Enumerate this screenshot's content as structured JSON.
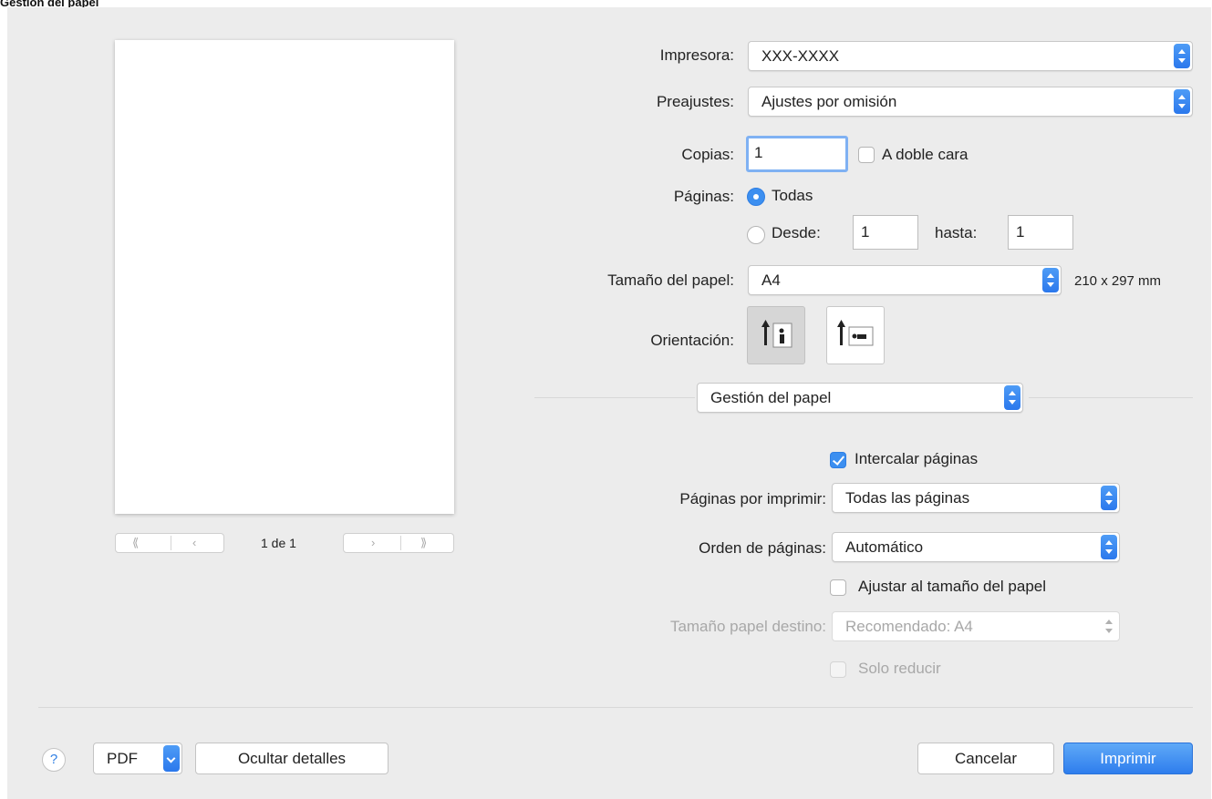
{
  "window": {
    "title": "Gestión del papel"
  },
  "preview": {
    "page_indicator": "1 de 1"
  },
  "printer": {
    "label": "Impresora:",
    "value": "XXX-XXXX"
  },
  "presets": {
    "label": "Preajustes:",
    "value": "Ajustes por omisión"
  },
  "copies": {
    "label": "Copias:",
    "value": "1",
    "duplex_label": "A doble cara",
    "duplex_checked": false
  },
  "pages": {
    "label": "Páginas:",
    "all_label": "Todas",
    "from_label": "Desde:",
    "from_value": "1",
    "to_label": "hasta:",
    "to_value": "1"
  },
  "paper_size": {
    "label": "Tamaño del papel:",
    "value": "A4",
    "dimensions": "210 x 297 mm"
  },
  "orientation": {
    "label": "Orientación:",
    "options": [
      "portrait-icon",
      "landscape-icon"
    ],
    "selected": "portrait"
  },
  "section": {
    "value": "Gestión del papel"
  },
  "paper_handling": {
    "collate_label": "Intercalar páginas",
    "collate_checked": true,
    "pages_to_print_label": "Páginas por imprimir:",
    "pages_to_print_value": "Todas las páginas",
    "page_order_label": "Orden de páginas:",
    "page_order_value": "Automático",
    "scale_to_fit_label": "Ajustar al tamaño del papel",
    "scale_to_fit_checked": false,
    "destination_size_label": "Tamaño papel destino:",
    "destination_size_value": "Recomendado: A4",
    "scale_down_only_label": "Solo reducir"
  },
  "footer": {
    "help": "?",
    "pdf": "PDF",
    "hide_details": "Ocultar detalles",
    "cancel": "Cancelar",
    "print": "Imprimir"
  },
  "colors": {
    "accent": "#3c8ff0",
    "background": "#ececec"
  }
}
